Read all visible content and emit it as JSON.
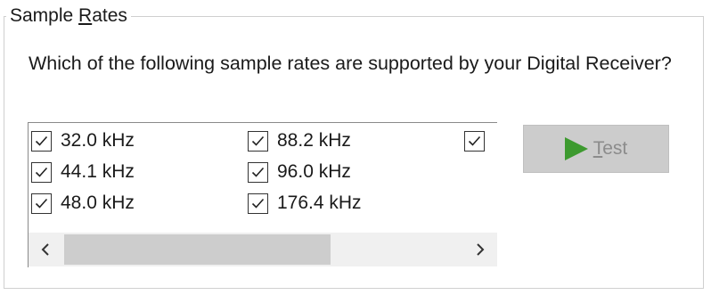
{
  "group": {
    "title_mnemonic": "S",
    "title_pre": "Sample ",
    "title_mn": "R",
    "title_post": "ates"
  },
  "question": "Which of the following sample rates are supported by your Digital Receiver?",
  "rates": [
    {
      "label": "32.0 kHz",
      "checked": true
    },
    {
      "label": "44.1 kHz",
      "checked": true
    },
    {
      "label": "48.0 kHz",
      "checked": true
    },
    {
      "label": "88.2 kHz",
      "checked": true
    },
    {
      "label": "96.0 kHz",
      "checked": true
    },
    {
      "label": "176.4 kHz",
      "checked": true
    },
    {
      "label": "",
      "checked": true
    }
  ],
  "scrollbar": {
    "left_arrow": "<",
    "right_arrow": ">"
  },
  "test_button": {
    "label_mn": "T",
    "label_rest": "est",
    "enabled": false,
    "icon": "play-icon",
    "icon_color": "#3d9a2f"
  }
}
